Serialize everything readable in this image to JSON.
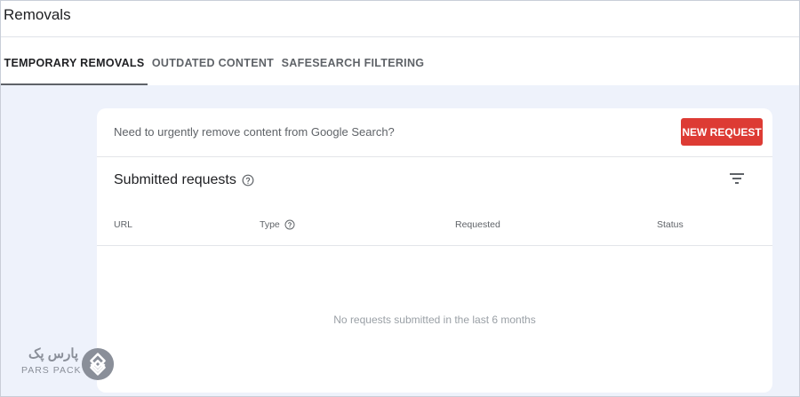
{
  "header": {
    "title": "Removals"
  },
  "tabs": [
    {
      "label": "TEMPORARY REMOVALS",
      "active": true
    },
    {
      "label": "OUTDATED CONTENT",
      "active": false
    },
    {
      "label": "SAFESEARCH FILTERING",
      "active": false
    }
  ],
  "banner": {
    "text": "Need to urgently remove content from Google Search?",
    "button_label": "NEW REQUEST"
  },
  "requests": {
    "title": "Submitted requests",
    "columns": [
      "URL",
      "Type",
      "Requested",
      "Status"
    ],
    "empty_message": "No requests submitted in the last 6 months"
  },
  "watermark": {
    "fa": "پارس پک",
    "en": "PARS PACK"
  },
  "icons": {
    "help": "help-circle-icon",
    "filter": "filter-icon",
    "logo": "parspack-logo-icon"
  },
  "colors": {
    "accent_button": "#dd3b34",
    "page_background": "#eef2fb"
  }
}
